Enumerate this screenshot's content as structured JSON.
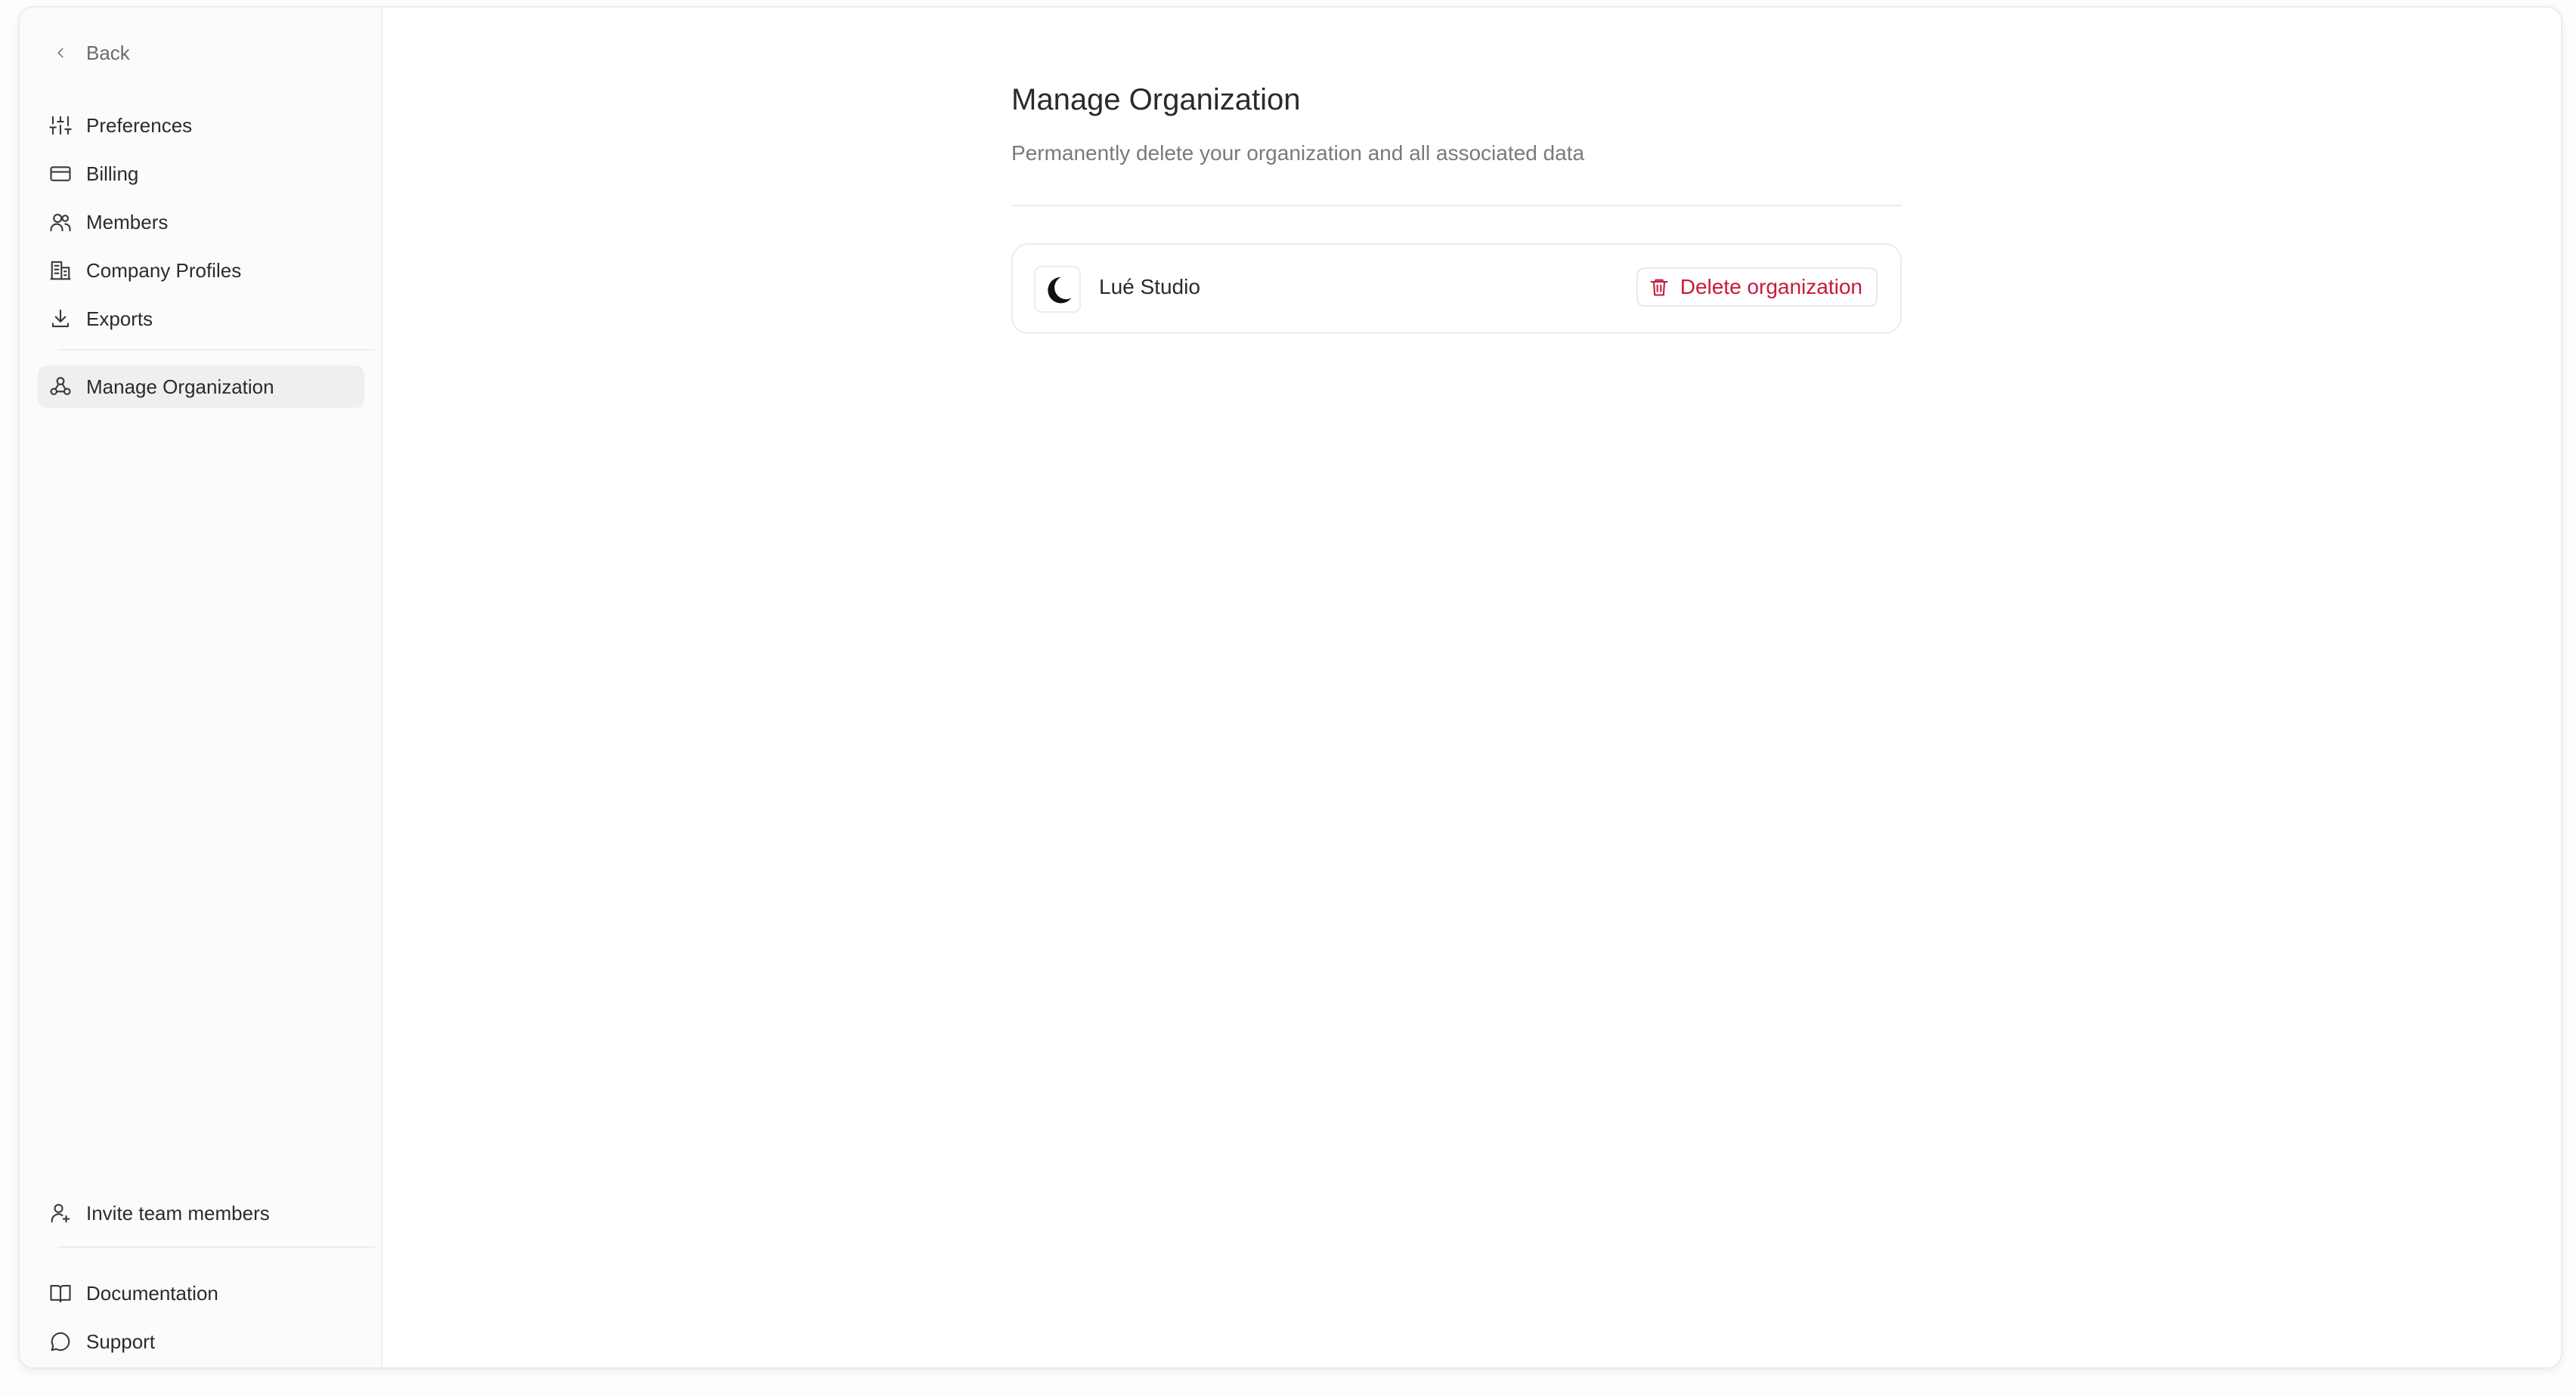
{
  "sidebar": {
    "back_label": "Back",
    "items": [
      {
        "label": "Preferences",
        "icon": "sliders-icon"
      },
      {
        "label": "Billing",
        "icon": "credit-card-icon"
      },
      {
        "label": "Members",
        "icon": "users-icon"
      },
      {
        "label": "Company Profiles",
        "icon": "building-icon"
      },
      {
        "label": "Exports",
        "icon": "download-icon"
      }
    ],
    "active_item": {
      "label": "Manage Organization",
      "icon": "organization-icon"
    },
    "bottom_items": [
      {
        "label": "Invite team members",
        "icon": "user-plus-icon"
      },
      {
        "label": "Documentation",
        "icon": "book-icon"
      },
      {
        "label": "Support",
        "icon": "message-circle-icon"
      }
    ]
  },
  "main": {
    "title": "Manage Organization",
    "subtitle": "Permanently delete your organization and all associated data",
    "organization": {
      "name": "Lué Studio",
      "delete_label": "Delete organization"
    }
  },
  "colors": {
    "danger": "#c8193f",
    "active_bg": "#efefef",
    "sidebar_bg": "#fbfbfb"
  }
}
